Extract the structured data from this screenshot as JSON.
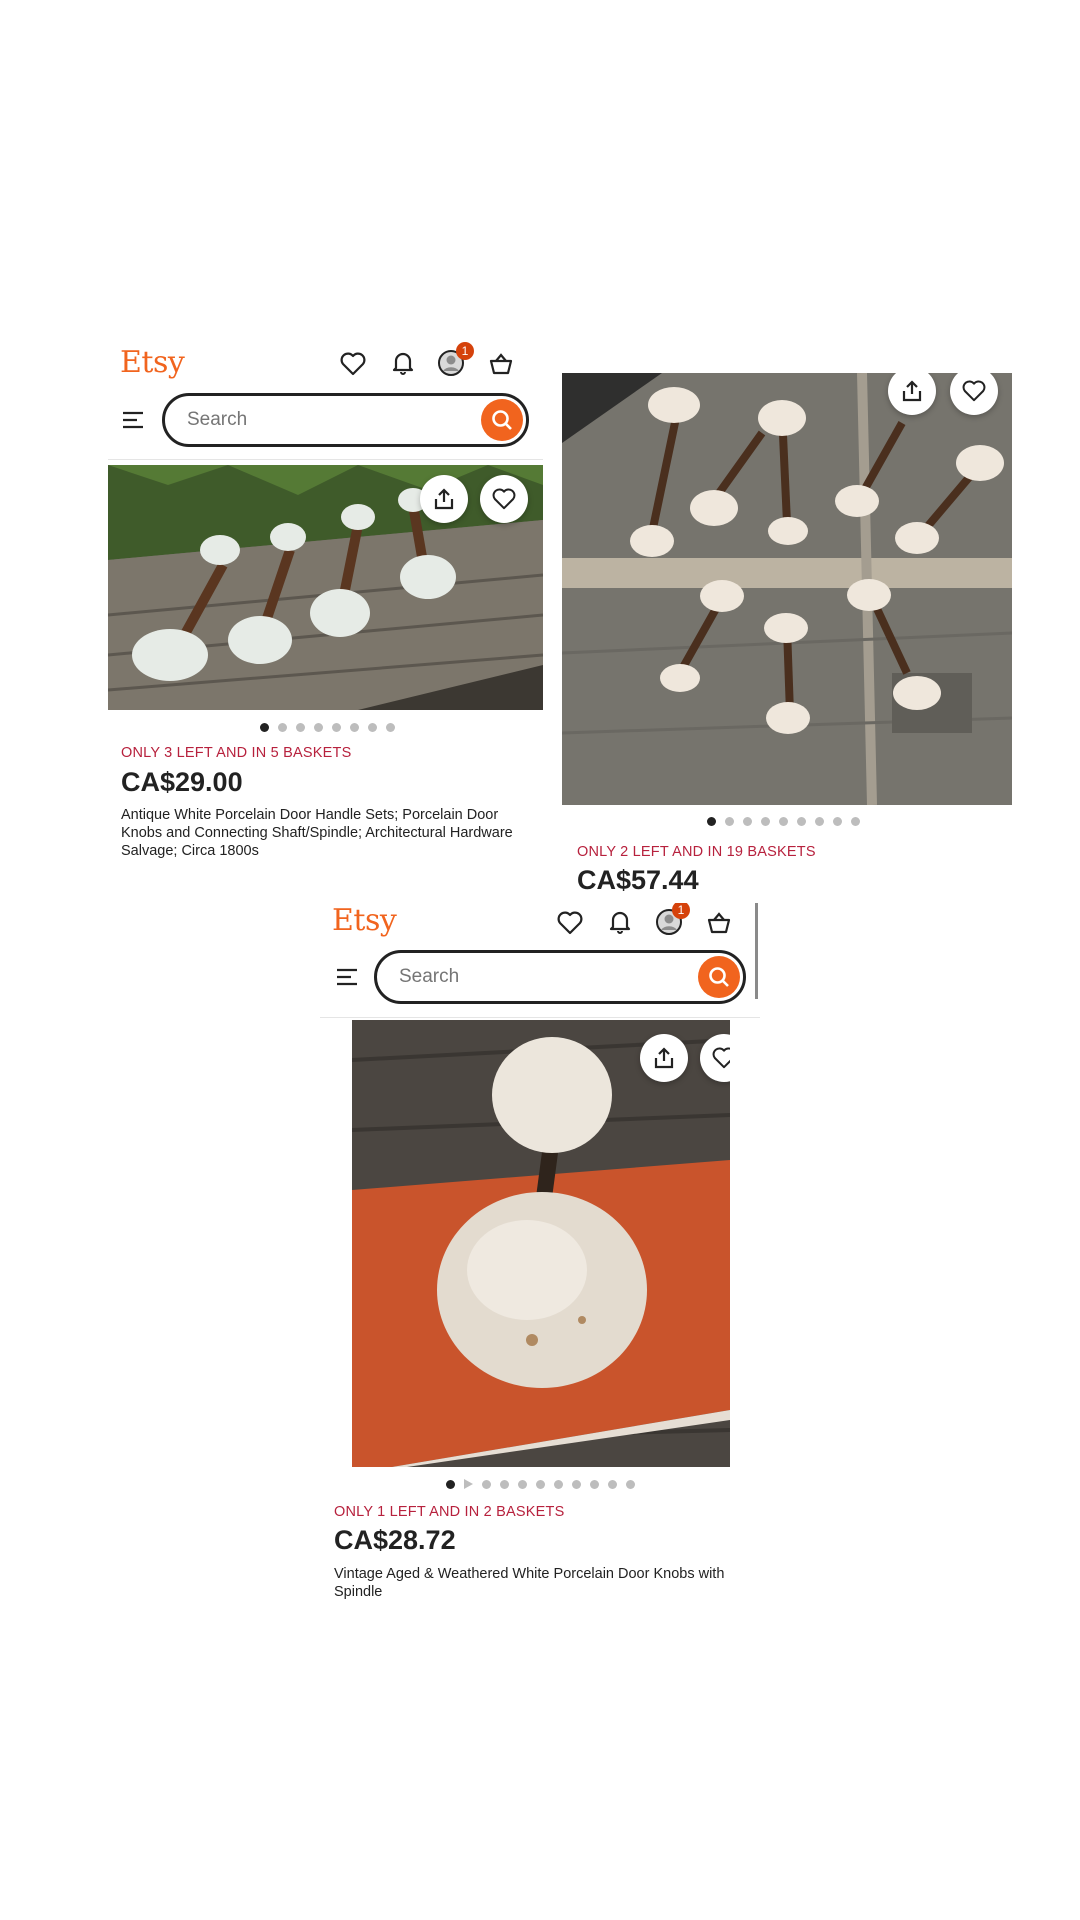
{
  "brand": {
    "logo": "Etsy",
    "accent": "#f1641e",
    "notification_count": "1"
  },
  "search": {
    "placeholder": "Search"
  },
  "icons": [
    "heart-icon",
    "bell-icon",
    "avatar-icon",
    "basket-icon",
    "menu-icon",
    "search-icon",
    "share-icon"
  ],
  "listings": [
    {
      "stock": "ONLY 3 LEFT AND IN 5 BASKETS",
      "price": "CA$29.00",
      "title": "Antique White Porcelain Door Handle Sets; Porcelain Door Knobs and Connecting Shaft/Spindle; Architectural Hardware Salvage; Circa 1800s",
      "image_count": 8,
      "active_image": 1
    },
    {
      "stock": "ONLY 2 LEFT AND IN 19 BASKETS",
      "price": "CA$57.44",
      "title": "",
      "image_count": 9,
      "active_image": 1
    },
    {
      "stock": "ONLY 1 LEFT AND IN 2 BASKETS",
      "price": "CA$28.72",
      "title": "Vintage Aged & Weathered White Porcelain Door Knobs with Spindle",
      "image_count": 11,
      "active_image": 1
    }
  ]
}
